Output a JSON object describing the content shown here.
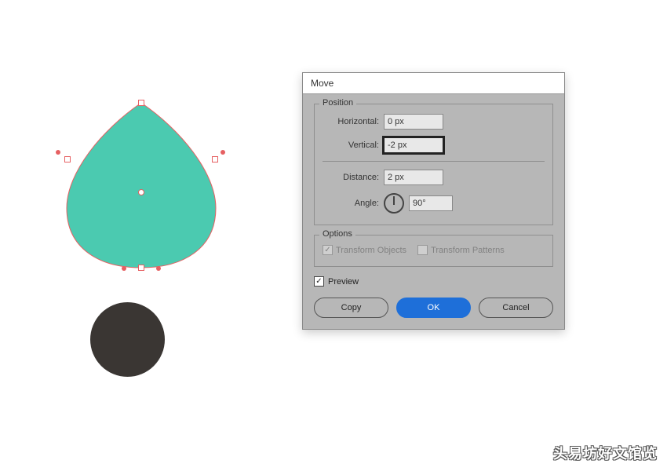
{
  "canvas": {
    "drop_fill": "#4bcab0",
    "drop_stroke": "#e66062",
    "circle_fill": "#3a3633"
  },
  "dialog": {
    "title": "Move",
    "position": {
      "legend": "Position",
      "horizontal_label": "Horizontal:",
      "horizontal_value": "0 px",
      "vertical_label": "Vertical:",
      "vertical_value": "-2 px",
      "distance_label": "Distance:",
      "distance_value": "2 px",
      "angle_label": "Angle:",
      "angle_value": "90°"
    },
    "options": {
      "legend": "Options",
      "transform_objects_label": "Transform Objects",
      "transform_objects_checked": true,
      "transform_patterns_label": "Transform Patterns",
      "transform_patterns_checked": false
    },
    "preview_label": "Preview",
    "preview_checked": true,
    "buttons": {
      "copy": "Copy",
      "ok": "OK",
      "cancel": "Cancel"
    }
  },
  "watermark": "头易坊好文馆览"
}
